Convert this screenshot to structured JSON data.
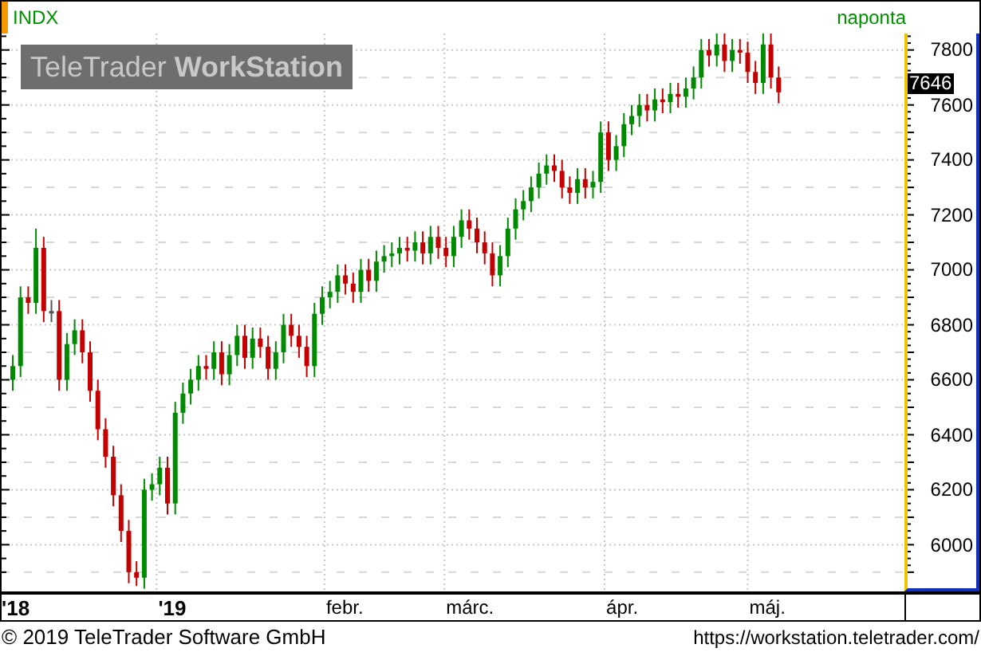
{
  "header": {
    "symbol": "INDX",
    "interval": "naponta"
  },
  "logo": {
    "text": "TeleTrader **WorkStation**"
  },
  "chart": {
    "last_price": "7646"
  },
  "price_axis": {
    "labels": [
      "7800",
      "7600",
      "7400",
      "7200",
      "7000",
      "6800",
      "6600",
      "6400",
      "6200",
      "6000"
    ]
  },
  "time_axis": {
    "labels": [
      {
        "text": "'18",
        "kind": "year"
      },
      {
        "text": "'19",
        "kind": "year"
      },
      {
        "text": "febr.",
        "kind": "month"
      },
      {
        "text": "márc.",
        "kind": "month"
      },
      {
        "text": "ápr.",
        "kind": "month"
      },
      {
        "text": "máj.",
        "kind": "month"
      }
    ]
  },
  "footer": {
    "copyright": "© 2019 TeleTrader Software GmbH",
    "url": "https://workstation.teletrader.com/"
  }
}
